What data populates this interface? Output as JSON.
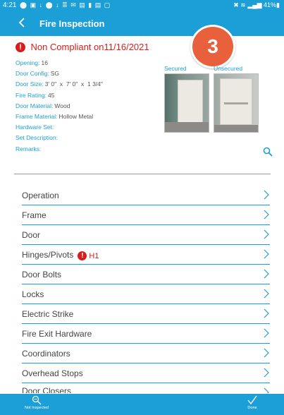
{
  "status_bar": {
    "time": "4:21",
    "left_icons": "⬤ ▣ ↓ ⬤ ↓ ≣ ✉ ▤ ▮ ▤ ▢",
    "right_icons": "✖ ≋ ▂▄▆ 41%▮"
  },
  "app_bar": {
    "title": "Fire Inspection",
    "back_icon": "chevron-left-icon"
  },
  "step_badge": "3",
  "compliance": {
    "text": "Non Compliant on11/16/2021",
    "alert_symbol": "!"
  },
  "details": [
    {
      "label": "Opening:",
      "value": "16"
    },
    {
      "label": "Door Config:",
      "value": "SG"
    },
    {
      "label": "Door Size:",
      "value": "3' 0\"  x  7' 0\"  x  1 3/4\""
    },
    {
      "label": "Fire Rating:",
      "value": "45"
    },
    {
      "label": "Door Material:",
      "value": "Wood"
    },
    {
      "label": "Frame Material:",
      "value": "Hollow Metal"
    },
    {
      "label": "Hardware Set:",
      "value": ""
    },
    {
      "label": "Set Description:",
      "value": ""
    },
    {
      "label": "Remarks:",
      "value": ""
    }
  ],
  "photos": {
    "secured_label": "Secured",
    "unsecured_label": "Unsecured"
  },
  "menu": [
    {
      "label": "Operation"
    },
    {
      "label": "Frame"
    },
    {
      "label": "Door"
    },
    {
      "label": "Hinges/Pivots",
      "flag": "H1"
    },
    {
      "label": "Door Bolts"
    },
    {
      "label": "Locks"
    },
    {
      "label": "Electric Strike"
    },
    {
      "label": "Fire Exit Hardware"
    },
    {
      "label": "Coordinators"
    },
    {
      "label": "Overhead Stops"
    },
    {
      "label": "Door Closers"
    }
  ],
  "bottom_bar": {
    "not_inspected_label": "Not Inspected",
    "done_label": "Done"
  },
  "colors": {
    "primary": "#1c9fd6",
    "alert": "#d81d1d",
    "badge": "#e8603c"
  }
}
